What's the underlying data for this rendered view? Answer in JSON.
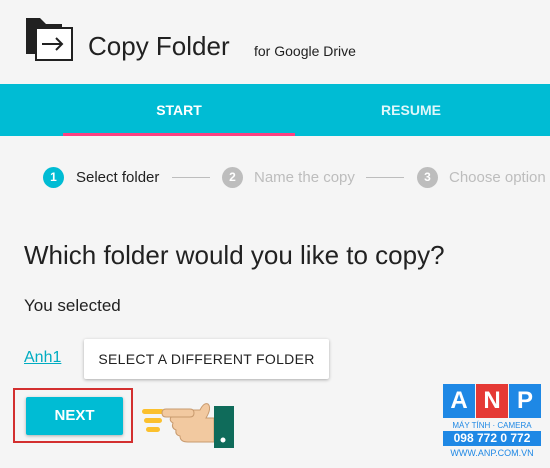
{
  "app": {
    "title": "Copy Folder",
    "subtitle": "for Google Drive"
  },
  "tabs": [
    {
      "label": "START",
      "active": true
    },
    {
      "label": "RESUME",
      "active": false
    }
  ],
  "steps": [
    {
      "number": "1",
      "label": "Select folder",
      "active": true
    },
    {
      "number": "2",
      "label": "Name the copy",
      "active": false
    },
    {
      "number": "3",
      "label": "Choose option",
      "active": false
    }
  ],
  "main": {
    "heading": "Which folder would you like to copy?",
    "selected_label": "You selected",
    "selected_folder": "Anh1",
    "different_folder_button": "SELECT A DIFFERENT FOLDER",
    "next_button": "NEXT"
  },
  "watermark": {
    "letters": [
      "A",
      "N",
      "P"
    ],
    "tagline": "MÁY TÍNH · CAMERA",
    "phone": "098 772 0 772",
    "website": "WWW.ANP.COM.VN"
  },
  "colors": {
    "accent": "#00bcd4",
    "tab_indicator": "#ff4081",
    "highlight": "#d32f2f",
    "step_inactive": "#bdbdbd"
  }
}
